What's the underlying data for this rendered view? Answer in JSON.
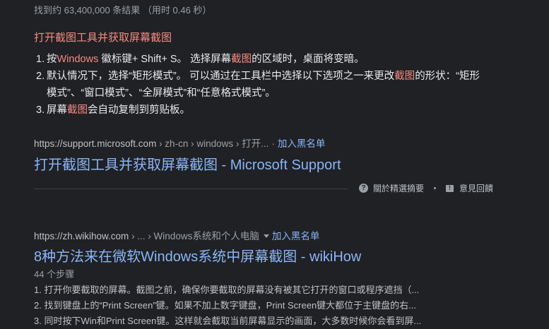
{
  "stats": "找到约 63,400,000 条结果 （用时 0.46 秒）",
  "snippet": {
    "title": "打开截图工具并获取屏幕截图",
    "steps": [
      {
        "n": "1.",
        "a": "按",
        "h1": "Windows",
        "b": " 徽标键+ Shift+ S。 选择屏幕",
        "h2": "截图",
        "c": "的区域时，桌面将变暗。"
      },
      {
        "n": "2.",
        "a": "默认情况下，选择“矩形模式”。 可以通过在工具栏中选择以下选项之一来更改",
        "h1": "截图",
        "b": "的形状：“矩形模式”、“窗口模式”、“全屏模式”和“任意格式模式”。"
      },
      {
        "n": "3.",
        "a": "屏幕",
        "h1": "截图",
        "b": "会自动复制到剪贴板。"
      }
    ]
  },
  "result1": {
    "domain": "https://support.microsoft.com",
    "path": " › zh-cn › windows › 打开...",
    "dot": "·",
    "blacklist": "加入黑名单",
    "title": "打开截图工具并获取屏幕截图 - Microsoft Support"
  },
  "feedback": {
    "about": "關於精選摘要",
    "report": "意見回饋"
  },
  "result2": {
    "domain": "https://zh.wikihow.com",
    "path": " › ... › Windows系统和个人电脑",
    "blacklist": "加入黑名单",
    "title": "8种方法来在微软Windows系统中屏幕截图 - wikiHow",
    "steps_count": "44 个步骤",
    "items": [
      "1.  打开你要截取的屏幕。截图之前，确保你要截取的屏幕没有被其它打开的窗口或程序遮挡（...",
      "2.  找到键盘上的“Print Screen”键。如果不加上数字键盘，Print Screen键大都位于主键盘的右...",
      "3.  同时按下Win和Print Screen键。这样就会截取当前屏幕显示的画面，大多数时候你会看到屏..."
    ]
  }
}
